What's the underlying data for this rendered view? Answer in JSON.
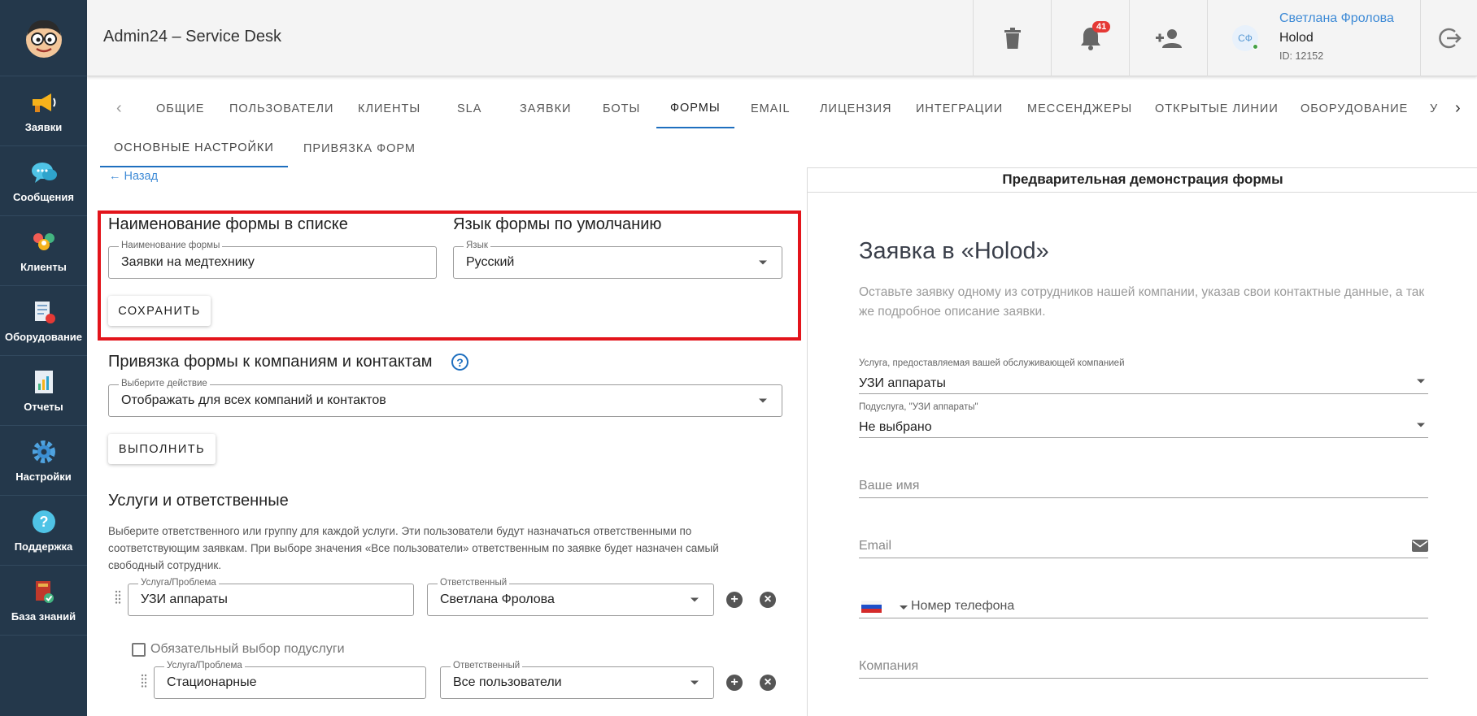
{
  "sidebar": {
    "items": [
      {
        "label": "Заявки",
        "icon": "megaphone-icon"
      },
      {
        "label": "Сообщения",
        "icon": "chat-icon"
      },
      {
        "label": "Клиенты",
        "icon": "clients-icon"
      },
      {
        "label": "Оборудование",
        "icon": "equipment-icon"
      },
      {
        "label": "Отчеты",
        "icon": "report-icon"
      },
      {
        "label": "Настройки",
        "icon": "gear-icon"
      },
      {
        "label": "Поддержка",
        "icon": "help-icon"
      },
      {
        "label": "База знаний",
        "icon": "book-icon"
      }
    ]
  },
  "header": {
    "title": "Admin24 – Service Desk",
    "notifications_count": "41",
    "user": {
      "initials": "СФ",
      "name": "Светлана Фролова",
      "org": "Holod",
      "id": "ID: 12152"
    }
  },
  "tabs": [
    "ОБЩИЕ",
    "ПОЛЬЗОВАТЕЛИ",
    "КЛИЕНТЫ",
    "SLA",
    "ЗАЯВКИ",
    "БОТЫ",
    "ФОРМЫ",
    "EMAIL",
    "ЛИЦЕНЗИЯ",
    "ИНТЕГРАЦИИ",
    "МЕССЕНДЖЕРЫ",
    "ОТКРЫТЫЕ ЛИНИИ",
    "ОБОРУДОВАНИЕ",
    "У"
  ],
  "active_tab": "ФОРМЫ",
  "subtabs": [
    "ОСНОВНЫЕ НАСТРОЙКИ",
    "ПРИВЯЗКА ФОРМ"
  ],
  "back_label": "← Назад",
  "form_name": {
    "section_title": "Наименование формы в списке",
    "field_label": "Наименование формы",
    "value": "Заявки на медтехнику"
  },
  "form_lang": {
    "section_title": "Язык формы по умолчанию",
    "field_label": "Язык",
    "value": "Русский"
  },
  "save_label": "СОХРАНИТЬ",
  "binding": {
    "section_title": "Привязка формы к компаниям и контактам",
    "help": "?",
    "field_label": "Выберите действие",
    "value": "Отображать для всех компаний и контактов",
    "run_label": "ВЫПОЛНИТЬ"
  },
  "services": {
    "section_title": "Услуги и ответственные",
    "description": "Выберите ответственного или группу для каждой услуги. Эти пользователи будут назначаться ответственными по соответствующим заявкам. При выборе значения «Все пользователи» ответственным по заявке будет назначен самый свободный сотрудник.",
    "service_label": "Услуга/Проблема",
    "responsible_label": "Ответственный",
    "row1": {
      "service": "УЗИ аппараты",
      "responsible": "Светлана Фролова"
    },
    "required_sub_label": "Обязательный выбор подуслуги",
    "row2": {
      "service": "Стационарные",
      "responsible": "Все пользователи"
    },
    "add": "+",
    "remove": "×"
  },
  "preview": {
    "header": "Предварительная демонстрация формы",
    "title": "Заявка в «Holod»",
    "description": "Оставьте заявку одному из сотрудников нашей компании, указав свои контактные данные, а так же подробное описание заявки.",
    "service_label": "Услуга, предоставляемая вашей обслуживающей компанией",
    "service_value": "УЗИ аппараты",
    "subservice_label": "Подуслуга, \"УЗИ аппараты\"",
    "subservice_value": "Не выбрано",
    "name_placeholder": "Ваше имя",
    "email_placeholder": "Email",
    "phone_placeholder": "Номер телефона",
    "company_placeholder": "Компания"
  },
  "colors": {
    "sidebar": "#24384b",
    "accent": "#1e6fbf",
    "highlight": "#e3141b",
    "link": "#3d8ad6"
  }
}
